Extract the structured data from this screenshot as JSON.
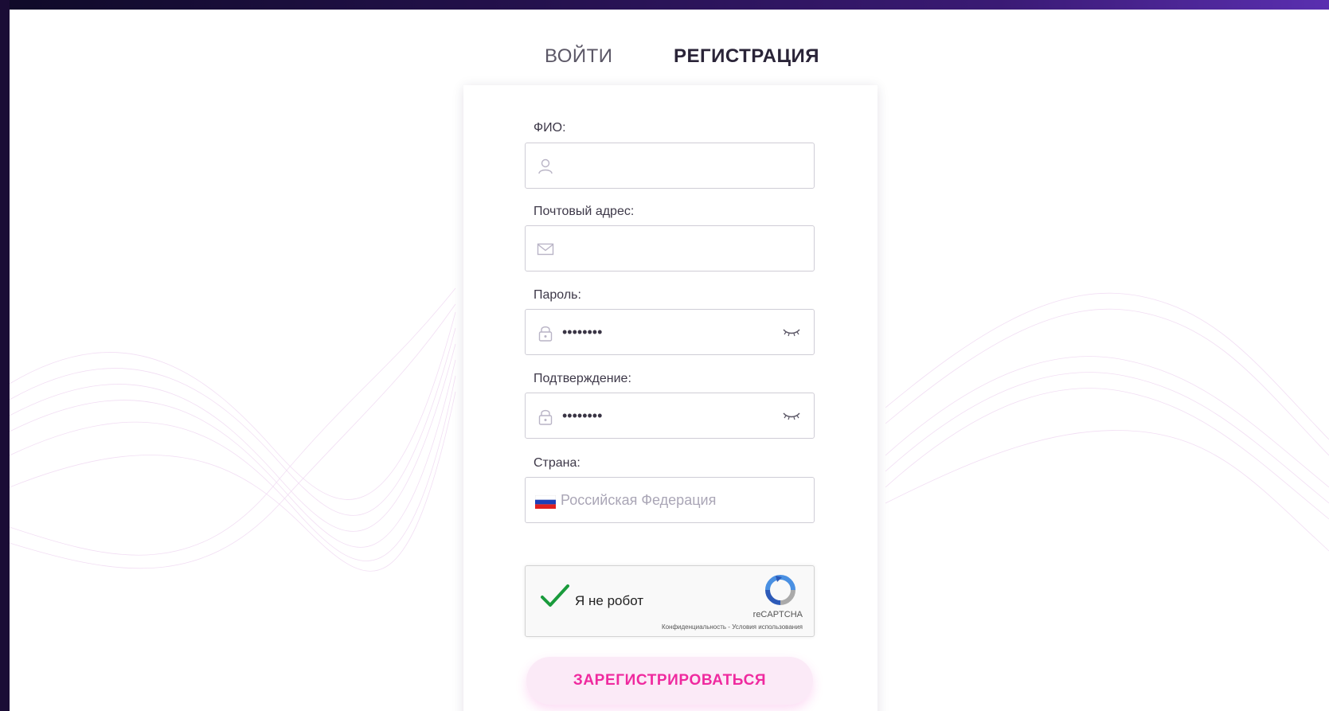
{
  "tabs": {
    "login": "ВОЙТИ",
    "register": "РЕГИСТРАЦИЯ",
    "active": "register"
  },
  "form": {
    "full_name": {
      "label": "ФИО:",
      "value": "",
      "icon": "user-icon"
    },
    "email": {
      "label": "Почтовый адрес:",
      "value": "",
      "icon": "envelope-icon"
    },
    "password": {
      "label": "Пароль:",
      "value": "••••••••",
      "icon": "lock-icon",
      "toggle_icon": "eye-closed-icon"
    },
    "confirm": {
      "label": "Подтверждение:",
      "value": "••••••••",
      "icon": "lock-icon",
      "toggle_icon": "eye-closed-icon"
    },
    "country": {
      "label": "Страна:",
      "value": "Российская Федерация",
      "icon": "russia-flag-icon"
    }
  },
  "captcha": {
    "text": "Я не робот",
    "brand": "reCAPTCHA",
    "links": "Конфиденциальность - Условия использования",
    "checked": true
  },
  "submit_label": "ЗАРЕГИСТРИРОВАТЬСЯ",
  "colors": {
    "accent": "#f03cc1",
    "button_text": "#ef2a9f",
    "button_bg": "#fbeaf7",
    "frame": "#1a0c35"
  }
}
